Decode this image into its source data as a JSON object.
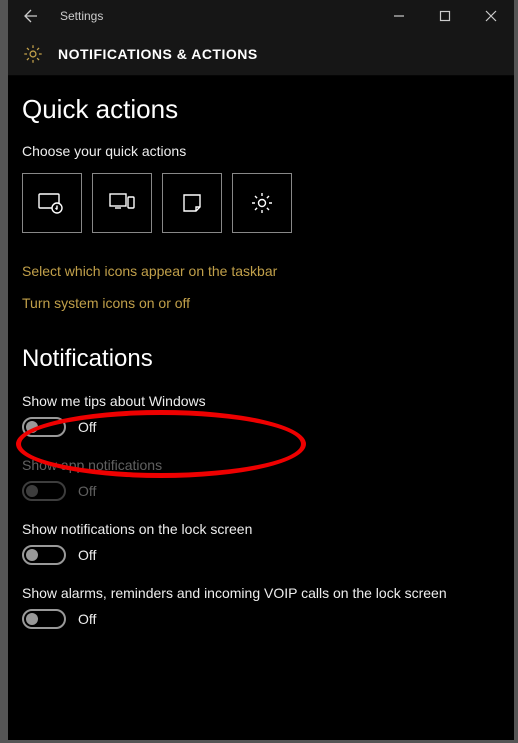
{
  "window": {
    "app_title": "Settings",
    "page_title": "NOTIFICATIONS & ACTIONS"
  },
  "quick_actions": {
    "heading": "Quick actions",
    "subtext": "Choose your quick actions",
    "tiles": [
      {
        "icon": "tablet-mode-icon"
      },
      {
        "icon": "connect-icon"
      },
      {
        "icon": "note-icon"
      },
      {
        "icon": "all-settings-icon"
      }
    ],
    "links": {
      "taskbar_icons": "Select which icons appear on the taskbar",
      "system_icons": "Turn system icons on or off"
    }
  },
  "notifications": {
    "heading": "Notifications",
    "settings": [
      {
        "label": "Show me tips about Windows",
        "state": "Off",
        "enabled": true
      },
      {
        "label": "Show app notifications",
        "state": "Off",
        "enabled": false
      },
      {
        "label": "Show notifications on the lock screen",
        "state": "Off",
        "enabled": true
      },
      {
        "label": "Show alarms, reminders and incoming VOIP calls on the lock screen",
        "state": "Off",
        "enabled": true
      }
    ]
  },
  "annotation": {
    "target": "Show me tips about Windows",
    "shape": "ellipse",
    "color": "#e00"
  }
}
